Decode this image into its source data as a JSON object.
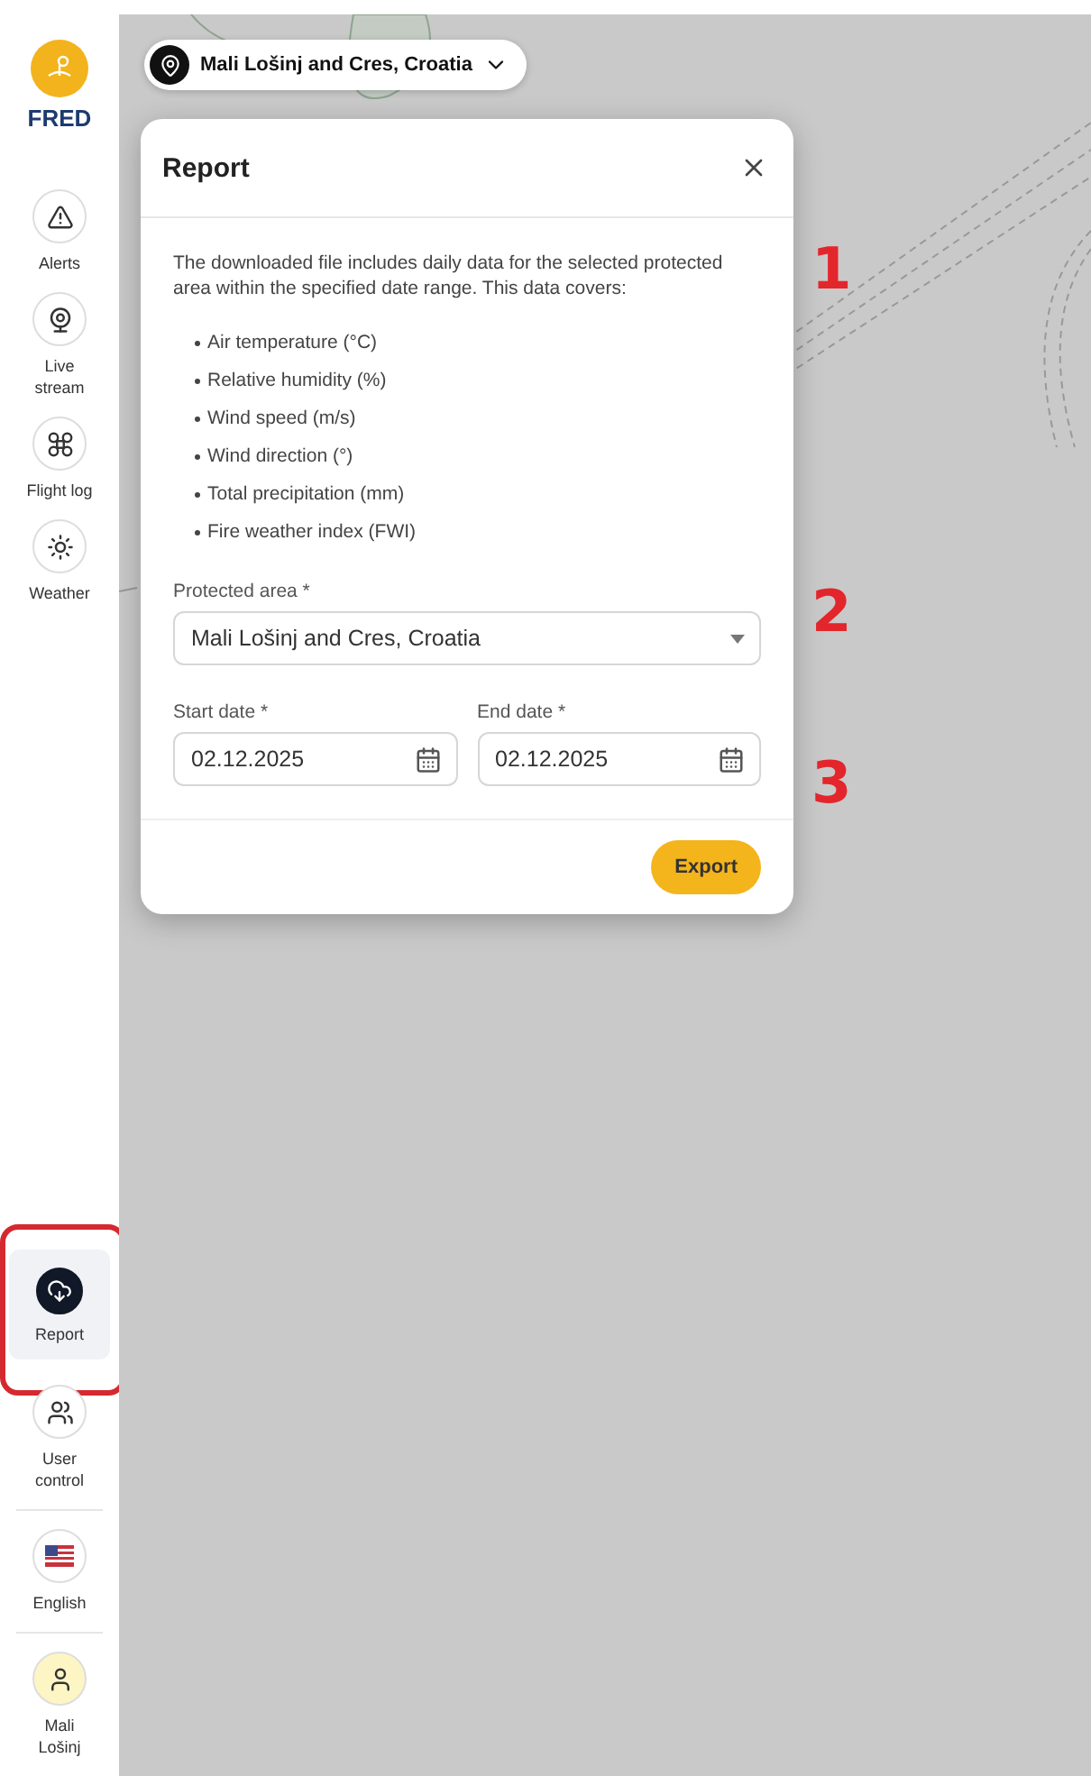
{
  "app": {
    "logo": "FRED"
  },
  "sidebar": {
    "top_items": [
      {
        "kind": "alert",
        "label": "Alerts",
        "selected": false
      },
      {
        "kind": "camera",
        "label": "Live stream",
        "selected": false
      },
      {
        "kind": "drone",
        "label": "Flight log",
        "selected": false
      },
      {
        "kind": "sun",
        "label": "Weather",
        "selected": false
      }
    ],
    "bottom_items": [
      {
        "kind": "download",
        "label": "Report",
        "selected": true
      },
      {
        "kind": "users",
        "label": "User control",
        "selected": false
      },
      {
        "kind": "flag",
        "label": "English",
        "selected": false
      },
      {
        "kind": "user",
        "label": "Mali Lošinj",
        "selected": false
      }
    ]
  },
  "location_selector": {
    "value": "Mali Lošinj and Cres, Croatia"
  },
  "dialog": {
    "title": "Report",
    "description": "The downloaded file includes daily data for the selected protected area within the specified date range. This data covers:",
    "bullets": [
      "Air temperature (°C)",
      "Relative humidity (%)",
      "Wind speed (m/s)",
      "Wind direction (°)",
      "Total precipitation (mm)",
      "Fire weather index (FWI)"
    ],
    "protected_area": {
      "label": "Protected area *",
      "value": "Mali Lošinj and Cres, Croatia"
    },
    "start_date": {
      "label": "Start date *",
      "value": "02.12.2025"
    },
    "end_date": {
      "label": "End date *",
      "value": "02.12.2025"
    },
    "buttons": [
      "Export"
    ]
  },
  "annotations": [
    "1",
    "2",
    "3"
  ]
}
